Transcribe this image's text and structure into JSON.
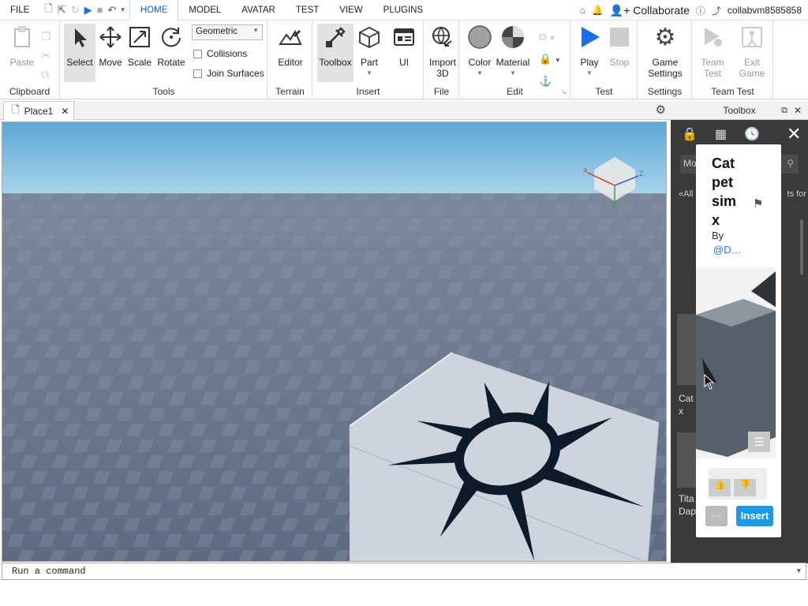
{
  "menubar": {
    "file": "FILE",
    "tabs": [
      "HOME",
      "MODEL",
      "AVATAR",
      "TEST",
      "VIEW",
      "PLUGINS"
    ],
    "active_tab": "HOME",
    "collaborate": "Collaborate",
    "username": "collabvm8585858"
  },
  "ribbon": {
    "clipboard": {
      "label": "Clipboard",
      "paste": "Paste"
    },
    "tools": {
      "label": "Tools",
      "select": "Select",
      "move": "Move",
      "scale": "Scale",
      "rotate": "Rotate",
      "mode": "Geometric",
      "collisions": "Collisions",
      "join_surfaces": "Join Surfaces"
    },
    "terrain": {
      "label": "Terrain",
      "editor": "Editor"
    },
    "insert": {
      "label": "Insert",
      "toolbox": "Toolbox",
      "part": "Part",
      "ui": "UI"
    },
    "file": {
      "label": "File",
      "import3d_line1": "Import",
      "import3d_line2": "3D"
    },
    "edit": {
      "label": "Edit",
      "color": "Color",
      "material": "Material"
    },
    "test": {
      "label": "Test",
      "play": "Play",
      "stop": "Stop"
    },
    "settings": {
      "label": "Settings",
      "game_line1": "Game",
      "game_line2": "Settings"
    },
    "team_test": {
      "label": "Team Test",
      "team_line1": "Team",
      "team_line2": "Test",
      "exit_line1": "Exit",
      "exit_line2": "Game"
    }
  },
  "doc_tab": {
    "name": "Place1"
  },
  "toolbox": {
    "title": "Toolbox",
    "partial_search": "Mo",
    "partial_back": "«All",
    "partial_right": "ts for",
    "partial_item1_l1": "Cat",
    "partial_item1_l2": "x",
    "partial_item2_l1": "Tita",
    "partial_item2_l2": "Dap"
  },
  "popup": {
    "title_lines": [
      "Cat",
      "pet",
      "sim",
      "x"
    ],
    "by": "By",
    "author": "@D…",
    "insert": "Insert"
  },
  "command_bar": {
    "placeholder": "Run a command"
  },
  "colors": {
    "accent": "#1560d0",
    "play": "#1a6ee8",
    "insert": "#1a9ae8",
    "sky_top": "#5ba8d6",
    "ground": "#6b7689"
  }
}
